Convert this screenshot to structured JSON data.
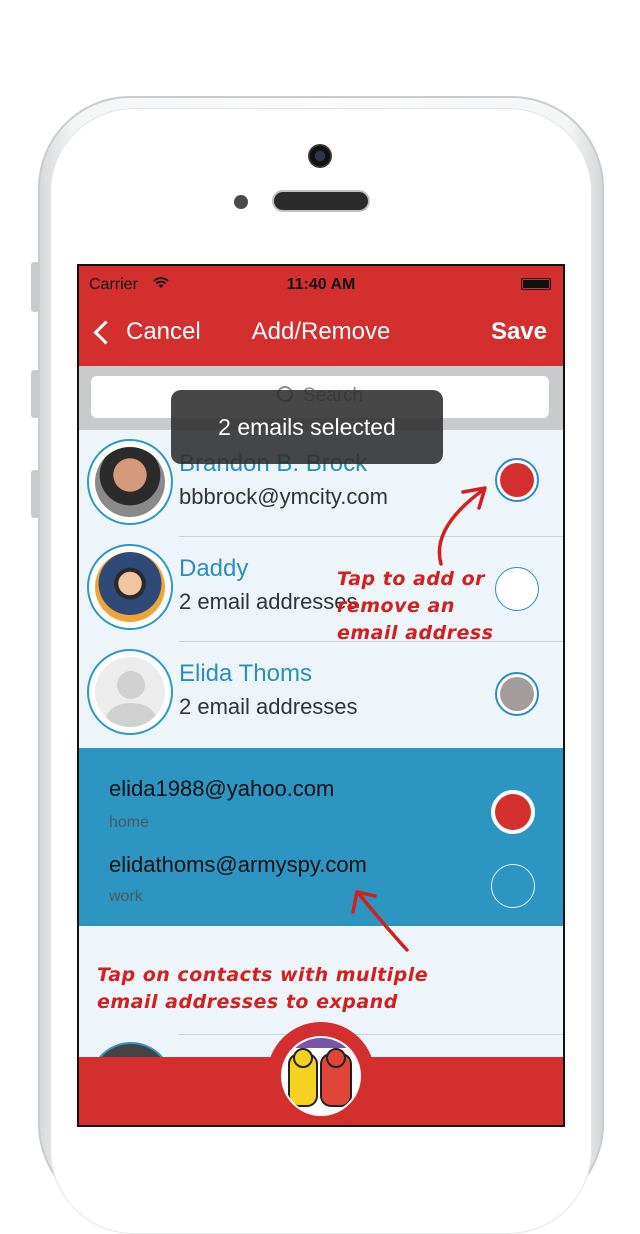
{
  "status_bar": {
    "carrier": "Carrier",
    "time": "11:40 AM"
  },
  "nav": {
    "back_label": "Cancel",
    "title": "Add/Remove",
    "save_label": "Save"
  },
  "search": {
    "placeholder": "Search"
  },
  "toast": "2 emails selected",
  "contacts": [
    {
      "name": "Brandon B. Brock",
      "detail": "bbbrock@ymcity.com",
      "state": "selected"
    },
    {
      "name": "Daddy",
      "detail": "2 email addresses",
      "state": "unselected"
    },
    {
      "name": "Elida Thoms",
      "detail": "2 email addresses",
      "state": "partial"
    }
  ],
  "expanded_emails": [
    {
      "address": "elida1988@yahoo.com",
      "label": "home",
      "state": "selected"
    },
    {
      "address": "elidathoms@armyspy.com",
      "label": "work",
      "state": "unselected"
    }
  ],
  "annotations": {
    "tap_add_remove": [
      "Tap to add or",
      "remove an",
      "email address"
    ],
    "tap_expand": [
      "Tap on contacts with multiple",
      "email addresses to expand"
    ]
  },
  "colors": {
    "brand_red": "#d32f2f",
    "accent_blue": "#2c8fbb",
    "expanded_bg": "#2d95c2"
  }
}
